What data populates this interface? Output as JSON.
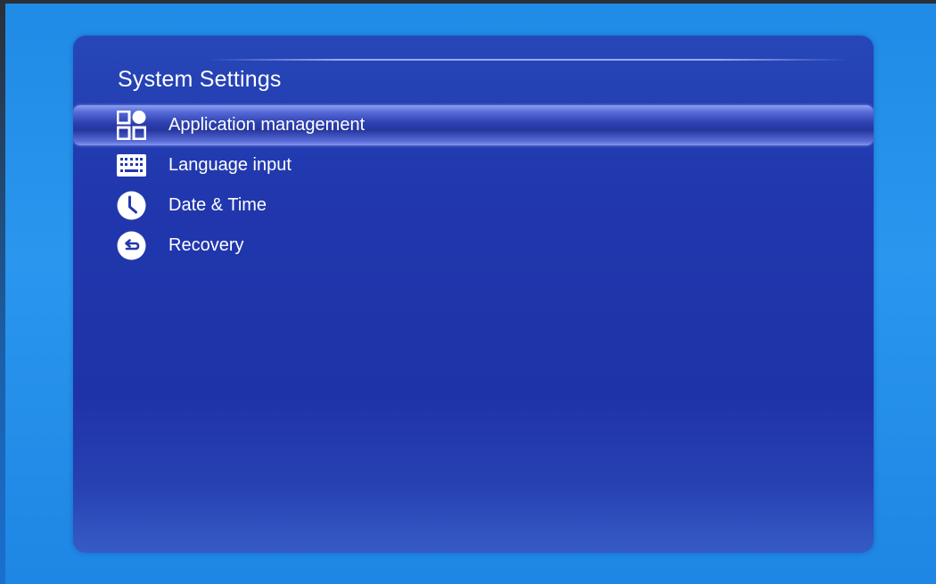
{
  "window": {
    "title": "System Settings"
  },
  "menu": {
    "items": [
      {
        "label": "Application management",
        "icon": "apps-grid-icon",
        "selected": true
      },
      {
        "label": "Language input",
        "icon": "keyboard-icon",
        "selected": false
      },
      {
        "label": "Date & Time",
        "icon": "clock-icon",
        "selected": false
      },
      {
        "label": "Recovery",
        "icon": "recovery-icon",
        "selected": false
      }
    ]
  },
  "colors": {
    "background": "#2a96ee",
    "panel": "#2137ad",
    "highlight": "#5468d6",
    "text": "#ffffff"
  }
}
